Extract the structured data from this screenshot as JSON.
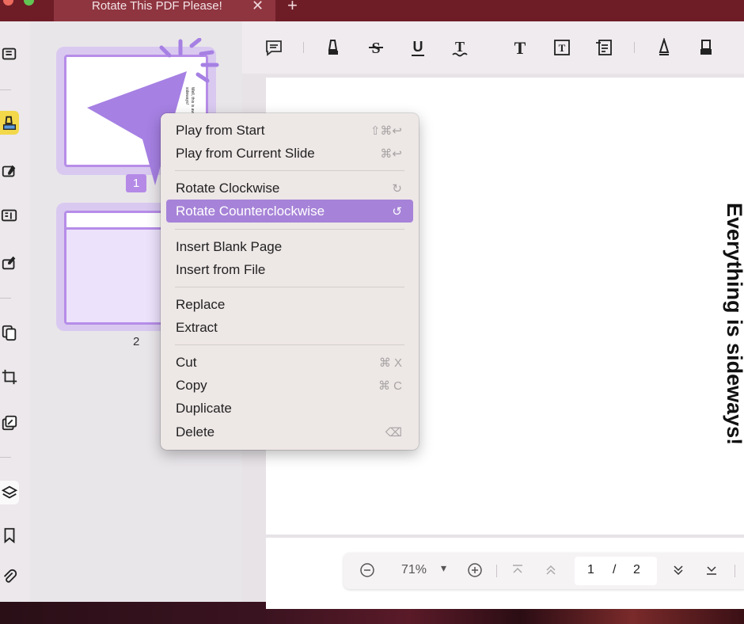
{
  "window": {
    "tab_title": "Rotate This PDF Please!",
    "close_glyph": "✕",
    "add_glyph": "+",
    "traffic_lights": [
      "#ec6a5e",
      "#f4bf4f",
      "#61c554"
    ]
  },
  "sidebar_icons": [
    "reader-icon",
    "highlighter-icon",
    "edit-text-icon",
    "form-icon",
    "sign-icon",
    "organize-pages-icon",
    "crop-icon",
    "compress-icon",
    "layers-icon",
    "bookmark-icon",
    "attachment-icon"
  ],
  "thumbnails": [
    {
      "number": "1",
      "selected": true,
      "text": "Well, this is awkward... Everything is sideways!"
    },
    {
      "number": "2",
      "selected": false
    }
  ],
  "toolbar_icons": [
    "comment-icon",
    "highlighter-icon",
    "strikethrough-icon",
    "underline-icon",
    "squiggly-underline-icon",
    "text-icon",
    "text-box-icon",
    "text-callout-icon",
    "pencil-icon",
    "eraser-icon"
  ],
  "document": {
    "page_text": "Everything is sideways!"
  },
  "bottom_bar": {
    "zoom": "71%",
    "zoom_caret": "▾",
    "current_page": "1",
    "separator": "/",
    "total_pages": "2"
  },
  "context_menu": {
    "items": [
      {
        "label": "Play from Start",
        "shortcut": "⇧⌘↩"
      },
      {
        "label": "Play from Current Slide",
        "shortcut": "⌘↩"
      },
      {
        "label": "Rotate Clockwise",
        "shortcut": "↻"
      },
      {
        "label": "Rotate Counterclockwise",
        "shortcut": "↺",
        "highlighted": true
      },
      {
        "label": "Insert Blank Page",
        "shortcut": ""
      },
      {
        "label": "Insert from File",
        "shortcut": ""
      },
      {
        "label": "Replace",
        "shortcut": ""
      },
      {
        "label": "Extract",
        "shortcut": ""
      },
      {
        "label": "Cut",
        "shortcut": "⌘ X"
      },
      {
        "label": "Copy",
        "shortcut": "⌘ C"
      },
      {
        "label": "Duplicate",
        "shortcut": ""
      },
      {
        "label": "Delete",
        "shortcut": "⌫"
      }
    ]
  },
  "colors": {
    "accent": "#a683d8",
    "titlebar": "#6e1d27",
    "highlight_yellow": "#f2d84a"
  }
}
